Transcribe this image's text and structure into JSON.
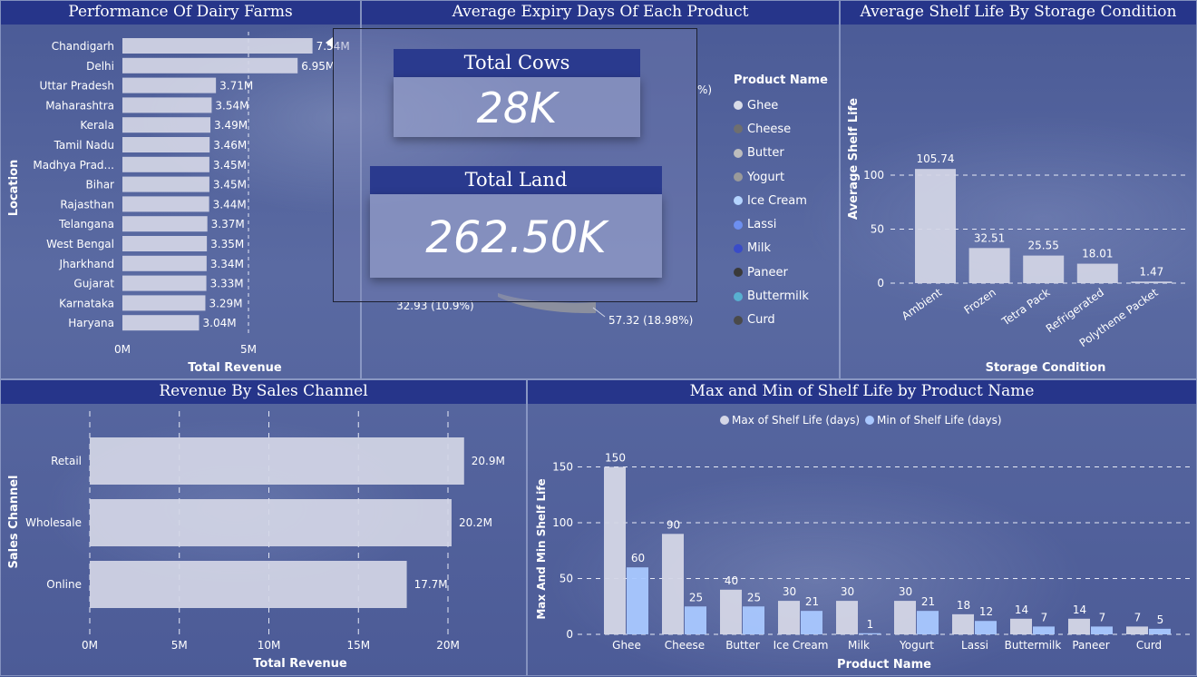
{
  "panels": {
    "farms": "Performance Of Dairy Farms",
    "expiry": "Average Expiry Days Of Each Product",
    "shelf": "Average Shelf Life By Storage Condition",
    "channel": "Revenue By Sales Channel",
    "maxmin": "Max and Min of Shelf Life by Product Name"
  },
  "kpis": {
    "cows_label": "Total Cows",
    "cows_value": "28K",
    "land_label": "Total Land",
    "land_value": "262.50K"
  },
  "pie": {
    "legend_title": "Product Name",
    "label_left": "32.93 (10.9%)",
    "label_right": "57.32 (18.98%)",
    "label_top_fragment": "%)",
    "legend": [
      {
        "name": "Ghee",
        "color": "#d8dce8"
      },
      {
        "name": "Cheese",
        "color": "#6f6f6f"
      },
      {
        "name": "Butter",
        "color": "#bdbdbd"
      },
      {
        "name": "Yogurt",
        "color": "#9a9a9a"
      },
      {
        "name": "Ice Cream",
        "color": "#b4d4ff"
      },
      {
        "name": "Lassi",
        "color": "#6d8ff0"
      },
      {
        "name": "Milk",
        "color": "#3a4cc8"
      },
      {
        "name": "Paneer",
        "color": "#3a3a3a"
      },
      {
        "name": "Buttermilk",
        "color": "#58b0d0"
      },
      {
        "name": "Curd",
        "color": "#4a4a4a"
      }
    ]
  },
  "chart_data": [
    {
      "type": "bar",
      "orientation": "horizontal",
      "title": "Performance Of Dairy Farms",
      "xlabel": "Total Revenue",
      "ylabel": "Location",
      "categories": [
        "Chandigarh",
        "Delhi",
        "Uttar Pradesh",
        "Maharashtra",
        "Kerala",
        "Tamil Nadu",
        "Madhya Prad...",
        "Bihar",
        "Rajasthan",
        "Telangana",
        "West Bengal",
        "Jharkhand",
        "Gujarat",
        "Karnataka",
        "Haryana"
      ],
      "values": [
        7.54,
        6.95,
        3.71,
        3.54,
        3.49,
        3.46,
        3.45,
        3.45,
        3.44,
        3.37,
        3.35,
        3.34,
        3.33,
        3.29,
        3.04
      ],
      "labels": [
        "7.54M",
        "6.95M",
        "3.71M",
        "3.54M",
        "3.49M",
        "3.46M",
        "3.45M",
        "3.45M",
        "3.44M",
        "3.37M",
        "3.35M",
        "3.34M",
        "3.33M",
        "3.29M",
        "3.04M"
      ],
      "xticks": [
        "0M",
        "5M"
      ],
      "xlim": [
        0,
        8.4
      ]
    },
    {
      "type": "bar",
      "title": "Average Shelf Life By Storage Condition",
      "xlabel": "Storage Condition",
      "ylabel": "Average Shelf Life",
      "categories": [
        "Ambient",
        "Frozen",
        "Tetra Pack",
        "Refrigerated",
        "Polythene Packet"
      ],
      "values": [
        105.74,
        32.51,
        25.55,
        18.01,
        1.47
      ],
      "labels": [
        "105.74",
        "32.51",
        "25.55",
        "18.01",
        "1.47"
      ],
      "yticks": [
        "0",
        "50",
        "100"
      ],
      "ylim": [
        0,
        118
      ]
    },
    {
      "type": "bar",
      "orientation": "horizontal",
      "title": "Revenue By Sales Channel",
      "xlabel": "Total Revenue",
      "ylabel": "Sales Channel",
      "categories": [
        "Retail",
        "Wholesale",
        "Online"
      ],
      "values": [
        20.9,
        20.2,
        17.7
      ],
      "labels": [
        "20.9M",
        "20.2M",
        "17.7M"
      ],
      "xticks": [
        "0M",
        "5M",
        "10M",
        "15M",
        "20M"
      ],
      "xlim": [
        0,
        22.5
      ]
    },
    {
      "type": "bar",
      "title": "Max and Min of Shelf Life by Product Name",
      "xlabel": "Product Name",
      "ylabel": "Max And Min Shelf Life",
      "categories": [
        "Ghee",
        "Cheese",
        "Butter",
        "Ice Cream",
        "Milk",
        "Yogurt",
        "Lassi",
        "Buttermilk",
        "Paneer",
        "Curd"
      ],
      "series": [
        {
          "name": "Max of Shelf Life (days)",
          "color": "#d4d6e6",
          "values": [
            150,
            90,
            40,
            30,
            30,
            30,
            18,
            14,
            14,
            7
          ]
        },
        {
          "name": "Min of Shelf Life (days)",
          "color": "#a9c8ff",
          "values": [
            60,
            25,
            25,
            21,
            1,
            21,
            12,
            7,
            7,
            5
          ]
        }
      ],
      "yticks": [
        "0",
        "50",
        "100",
        "150"
      ],
      "ylim": [
        0,
        165
      ]
    }
  ]
}
